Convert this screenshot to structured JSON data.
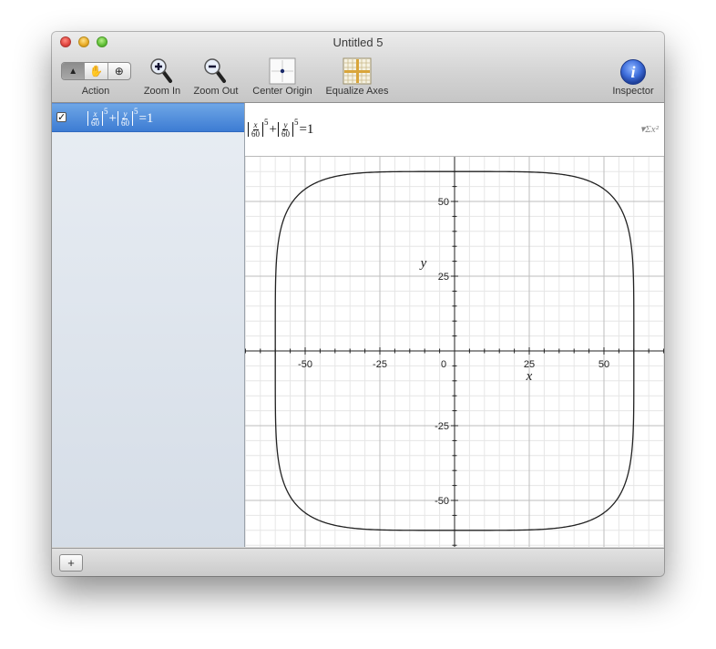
{
  "window": {
    "title": "Untitled 5"
  },
  "toolbar": {
    "action_label": "Action",
    "zoom_in_label": "Zoom In",
    "zoom_out_label": "Zoom Out",
    "center_origin_label": "Center Origin",
    "equalize_axes_label": "Equalize Axes",
    "inspector_label": "Inspector",
    "inspector_glyph": "i",
    "tools": {
      "pointer": "▲",
      "hand": "✋",
      "zoom": "⊕"
    }
  },
  "sidebar": {
    "equation": {
      "checked": "✓",
      "x_num": "x",
      "x_den": "60",
      "y_num": "y",
      "y_den": "60",
      "exp1": "5",
      "plus": "+",
      "exp2": "5",
      "eq": "=1"
    }
  },
  "editor": {
    "equation": {
      "x_num": "x",
      "x_den": "60",
      "y_num": "y",
      "y_den": "60",
      "exp1": "5",
      "plus": "+",
      "exp2": "5",
      "eq": "=1"
    },
    "sigma_menu": "▾Σx²"
  },
  "bottombar": {
    "add_label": "+"
  },
  "chart_data": {
    "type": "line",
    "title": "",
    "xlabel": "x",
    "ylabel": "y",
    "xlim": [
      -70,
      70
    ],
    "ylim": [
      -65,
      65
    ],
    "xticks": [
      "-50",
      "-25",
      "0",
      "25",
      "50"
    ],
    "yticks": [
      "50",
      "25",
      "-25",
      "-50"
    ],
    "grid": true,
    "series": [
      {
        "equation": "|x/60|^5 + |y/60|^5 = 1",
        "color": "#222222"
      }
    ]
  }
}
